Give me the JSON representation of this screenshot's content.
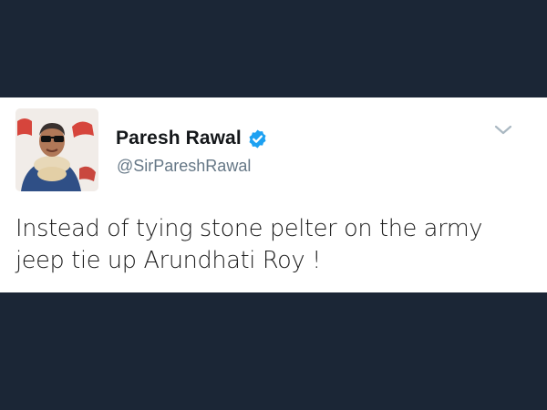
{
  "tweet": {
    "display_name": "Paresh Rawal",
    "handle": "@SirPareshRawal",
    "text": "Instead of tying stone pelter on the army jeep tie up Arundhati Roy !",
    "verified": true
  },
  "icons": {
    "verified": "verified-badge-icon",
    "caret": "chevron-down-icon"
  },
  "colors": {
    "background": "#1b2636",
    "card": "#ffffff",
    "verified_blue": "#1da1f2",
    "handle_gray": "#657786",
    "caret_gray": "#aab8c2"
  }
}
